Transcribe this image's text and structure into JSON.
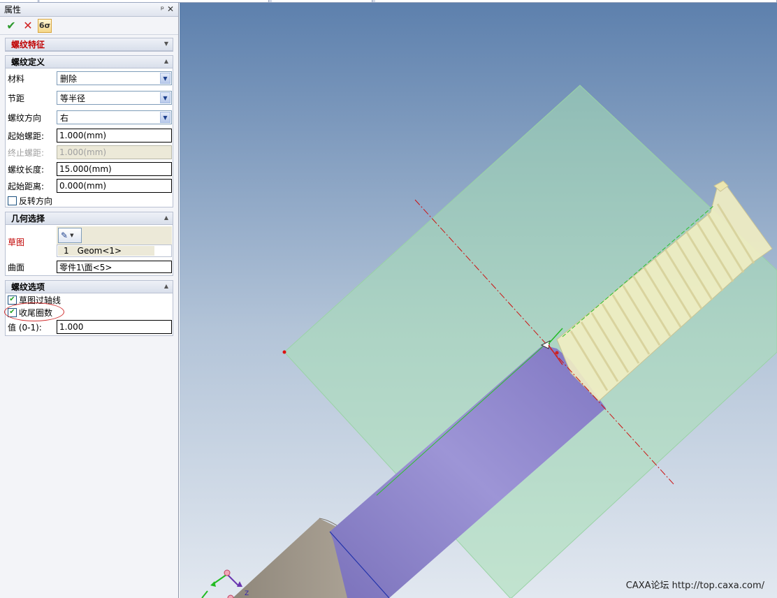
{
  "panel": {
    "title": "属性",
    "pin_glyph": "ᵖ",
    "close_glyph": "✕",
    "toolbar": {
      "ok_icon": "check-icon",
      "cancel_icon": "cross-icon",
      "preview_icon": "preview-glasses-icon",
      "preview_glyph": "6σ"
    }
  },
  "thread_feature": {
    "header": "螺纹特征"
  },
  "thread_definition": {
    "header": "螺纹定义",
    "material_label": "材料",
    "material_value": "删除",
    "pitch_label": "节距",
    "pitch_value": "等半径",
    "direction_label": "螺纹方向",
    "direction_value": "右",
    "start_pitch_label": "起始螺距:",
    "start_pitch_value": "1.000(mm)",
    "end_pitch_label": "终止螺距:",
    "end_pitch_value": "1.000(mm)",
    "length_label": "螺纹长度:",
    "length_value": "15.000(mm)",
    "start_distance_label": "起始距离:",
    "start_distance_value": "0.000(mm)",
    "reverse_label": "反转方向",
    "reverse_checked": false
  },
  "geometry_selection": {
    "header": "几何选择",
    "sketch_label": "草图",
    "sketch_item_index": "1",
    "sketch_item_name": "Geom<1>",
    "surface_label": "曲面",
    "surface_value": "零件1\\面<5>"
  },
  "thread_options": {
    "header": "螺纹选项",
    "sketch_through_axis_label": "草图过轴线",
    "sketch_through_axis_checked": true,
    "tail_turns_label": "收尾圈数",
    "tail_turns_checked": true,
    "value_label": "值 (0-1):",
    "value_value": "1.000"
  },
  "viewport": {
    "watermark": "CAXA论坛 http://top.caxa.com/",
    "colors": {
      "bg_top": "#5d80ad",
      "bg_bottom": "#e2e8f0",
      "plane": "#a8e0b4",
      "shaft": "#8f86cc",
      "base": "#a59c8e",
      "thread": "#f2eec2",
      "axis_line": "#cc1111"
    }
  }
}
